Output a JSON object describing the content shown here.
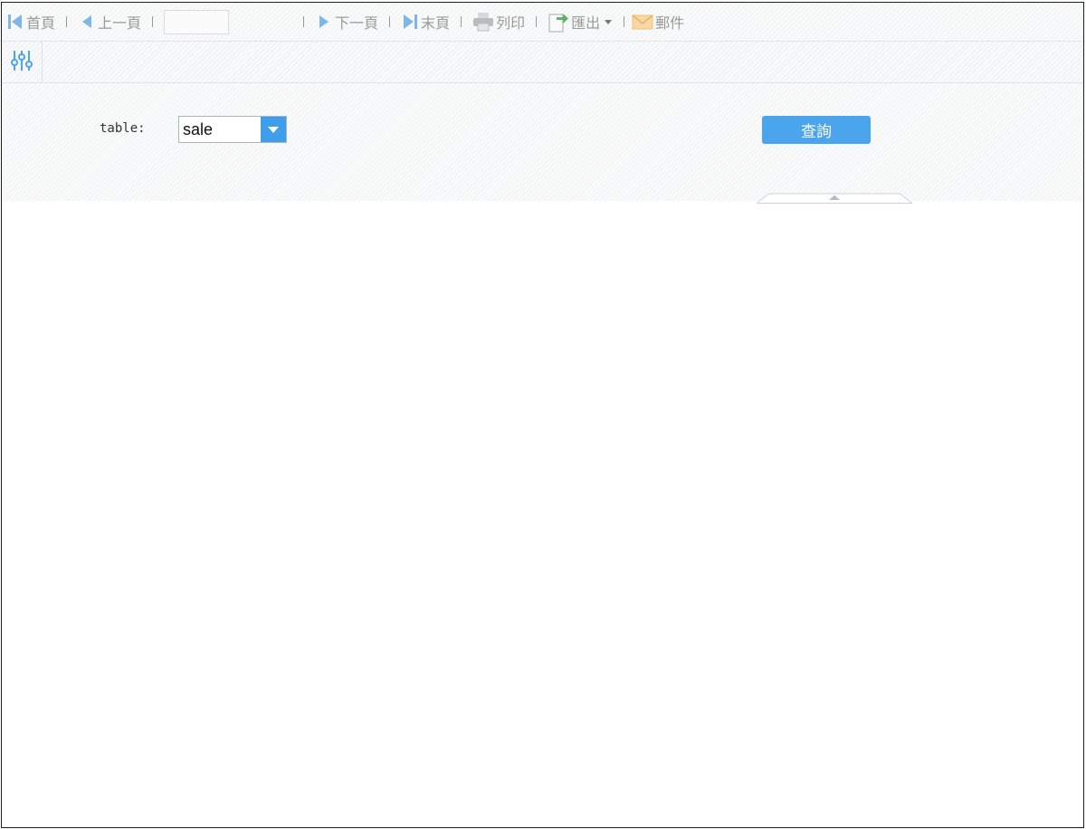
{
  "toolbar": {
    "first": "首頁",
    "prev": "上一頁",
    "page_value": "",
    "next": "下一頁",
    "last": "末頁",
    "print": "列印",
    "export": "匯出",
    "email": "郵件"
  },
  "params": {
    "table_label": "table:",
    "table_value": "sale",
    "query_label": "查詢"
  },
  "colors": {
    "accent": "#4aa5ec",
    "nav_icon": "#7fb6e6",
    "print_icon": "#b8bcc0",
    "export_icon": "#61b06a",
    "email_icon": "#f2c17c"
  }
}
